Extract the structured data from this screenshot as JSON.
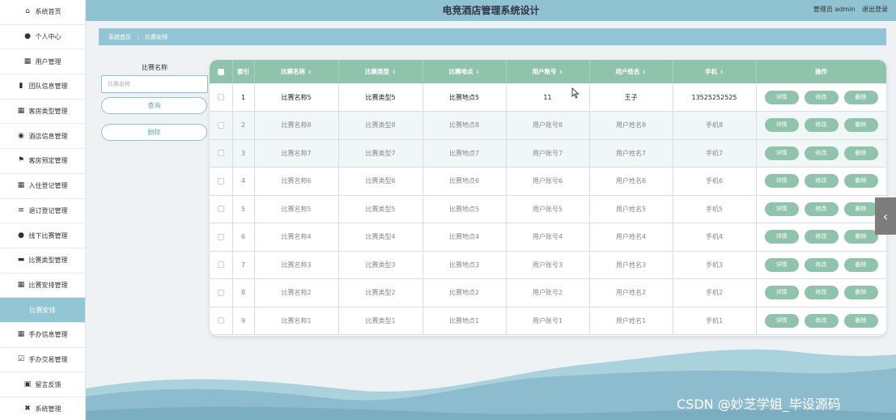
{
  "sidebar": {
    "items": [
      {
        "label": "系统首页",
        "icon": "home-icon",
        "glyph": "⌂"
      },
      {
        "label": "个人中心",
        "icon": "user-icon",
        "glyph": "●"
      },
      {
        "label": "用户管理",
        "icon": "grid-icon",
        "glyph": "▦"
      },
      {
        "label": "团队信息管理",
        "icon": "bar-chart-icon",
        "glyph": "▮"
      },
      {
        "label": "客房类型管理",
        "icon": "grid-icon",
        "glyph": "▦"
      },
      {
        "label": "酒店信息管理",
        "icon": "location-pin-icon",
        "glyph": "◉"
      },
      {
        "label": "客房预定管理",
        "icon": "flag-icon",
        "glyph": "⚑"
      },
      {
        "label": "入住登记管理",
        "icon": "grid-icon",
        "glyph": "▦"
      },
      {
        "label": "退订登记管理",
        "icon": "list-icon",
        "glyph": "≡"
      },
      {
        "label": "线下比赛管理",
        "icon": "user-icon",
        "glyph": "●"
      },
      {
        "label": "比赛类型管理",
        "icon": "briefcase-icon",
        "glyph": "▬"
      },
      {
        "label": "比赛安排管理",
        "icon": "grid-icon",
        "glyph": "▦"
      },
      {
        "label": "比赛安排",
        "icon": "",
        "glyph": "",
        "active": true
      },
      {
        "label": "手办信息管理",
        "icon": "grid-icon",
        "glyph": "▦"
      },
      {
        "label": "手办交易管理",
        "icon": "checklist-icon",
        "glyph": "☑"
      },
      {
        "label": "留言反馈",
        "icon": "calendar-icon",
        "glyph": "▣"
      },
      {
        "label": "系统管理",
        "icon": "ticket-icon",
        "glyph": "✖"
      }
    ]
  },
  "header": {
    "title": "电竞酒店管理系统设计",
    "admin": "管理员 admin",
    "logout": "退出登录"
  },
  "breadcrumb": {
    "home": "系统首页",
    "sep": "⋮",
    "current": "比赛安排"
  },
  "filters": {
    "label": "比赛名称",
    "placeholder": "比赛名称",
    "query": "查询",
    "delete": "删除"
  },
  "table": {
    "headers": [
      "索引",
      "比赛名称",
      "比赛类型",
      "比赛地点",
      "用户账号",
      "用户姓名",
      "手机",
      "操作"
    ],
    "sortable": [
      false,
      true,
      true,
      true,
      true,
      true,
      true,
      false
    ],
    "actions": [
      "详情",
      "修改",
      "删除"
    ],
    "rows": [
      [
        "1",
        "比赛名称5",
        "比赛类型5",
        "比赛地点5",
        "11",
        "王子",
        "13525252525"
      ],
      [
        "2",
        "比赛名称8",
        "比赛类型8",
        "比赛地点8",
        "用户账号8",
        "用户姓名8",
        "手机8"
      ],
      [
        "3",
        "比赛名称7",
        "比赛类型7",
        "比赛地点7",
        "用户账号7",
        "用户姓名7",
        "手机7"
      ],
      [
        "4",
        "比赛名称6",
        "比赛类型6",
        "比赛地点6",
        "用户账号6",
        "用户姓名6",
        "手机6"
      ],
      [
        "5",
        "比赛名称5",
        "比赛类型5",
        "比赛地点5",
        "用户账号5",
        "用户姓名5",
        "手机5"
      ],
      [
        "6",
        "比赛名称4",
        "比赛类型4",
        "比赛地点4",
        "用户账号4",
        "用户姓名4",
        "手机4"
      ],
      [
        "7",
        "比赛名称3",
        "比赛类型3",
        "比赛地点3",
        "用户账号3",
        "用户姓名3",
        "手机3"
      ],
      [
        "8",
        "比赛名称2",
        "比赛类型2",
        "比赛地点2",
        "用户账号2",
        "用户姓名2",
        "手机2"
      ],
      [
        "9",
        "比赛名称1",
        "比赛类型1",
        "比赛地点1",
        "用户账号1",
        "用户姓名1",
        "手机1"
      ]
    ]
  },
  "side_tab": {
    "icon": "chevron-left-icon",
    "glyph": "‹"
  },
  "watermark": "CSDN @妙芝学姐_毕设源码",
  "colors": {
    "accent": "#8fc3d1",
    "table_header": "#8fc3ac",
    "active_sidebar": "#93c6d4"
  }
}
